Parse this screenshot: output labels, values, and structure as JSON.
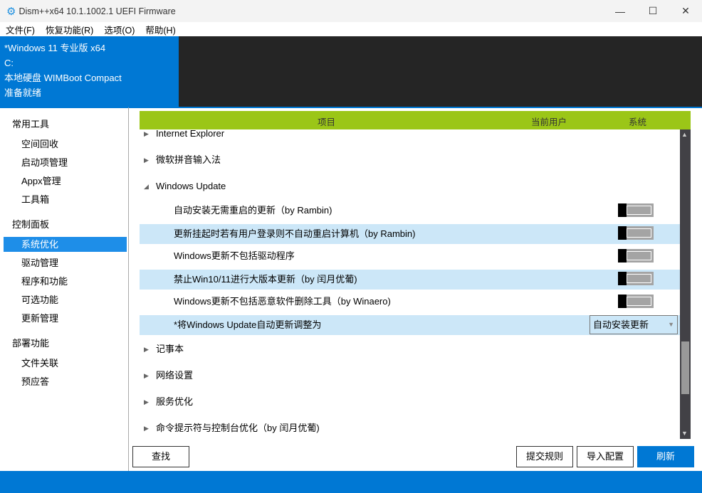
{
  "window": {
    "title": "Dism++x64 10.1.1002.1 UEFI Firmware",
    "minimize": "—",
    "maximize": "☐",
    "close": "✕"
  },
  "menu": [
    "文件(F)",
    "恢复功能(R)",
    "选项(O)",
    "帮助(H)"
  ],
  "info": [
    "*Windows 11 专业版 x64",
    "C:",
    "本地硬盘 WIMBoot Compact",
    "准备就绪"
  ],
  "sidebar": {
    "sections": [
      {
        "title": "常用工具",
        "items": [
          "空间回收",
          "启动项管理",
          "Appx管理",
          "工具箱"
        ]
      },
      {
        "title": "控制面板",
        "items": [
          "系统优化",
          "驱动管理",
          "程序和功能",
          "可选功能",
          "更新管理"
        ]
      },
      {
        "title": "部署功能",
        "items": [
          "文件关联",
          "预应答"
        ]
      }
    ],
    "selected": "系统优化"
  },
  "table": {
    "headers": [
      "项目",
      "当前用户",
      "系统"
    ],
    "groups_top": [
      "Internet Explorer",
      "微软拼音输入法",
      "Windows Update"
    ],
    "options": [
      {
        "label": "自动安装无需重启的更新（by Rambin)",
        "system": "off"
      },
      {
        "label": "更新挂起时若有用户登录则不自动重启计算机（by Rambin)",
        "system": "off"
      },
      {
        "label": "Windows更新不包括驱动程序",
        "system": "off"
      },
      {
        "label": "禁止Win10/11进行大版本更新（by 闰月优葡)",
        "system": "off"
      },
      {
        "label": "Windows更新不包括恶意软件删除工具（by Winaero)",
        "system": "off"
      },
      {
        "label": "*将Windows Update自动更新调整为",
        "dropdown": "自动安装更新"
      }
    ],
    "groups_bottom": [
      "记事本",
      "网络设置",
      "服务优化",
      "命令提示符与控制台优化（by 闰月优葡)"
    ]
  },
  "buttons": {
    "find": "查找",
    "submit_rule": "提交规则",
    "import": "导入配置",
    "refresh": "刷新"
  },
  "colors": {
    "accent": "#0078d4",
    "header": "#9bc617",
    "highlight": "#cce7f8"
  }
}
